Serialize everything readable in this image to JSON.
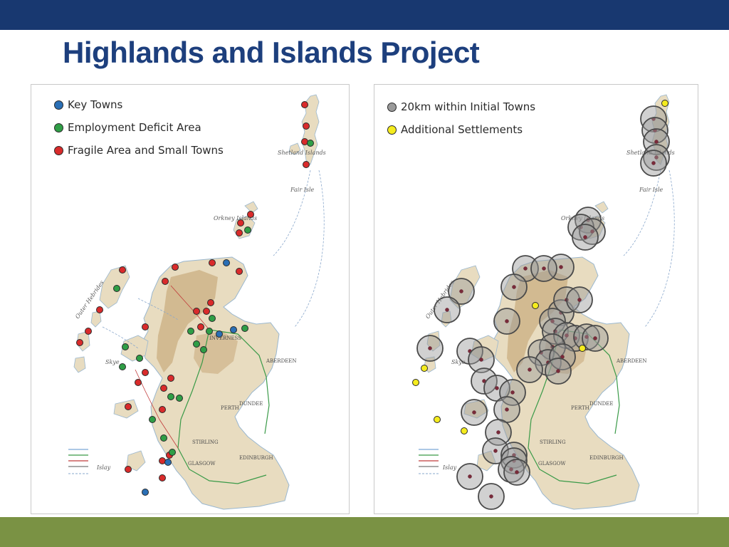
{
  "slide": {
    "title": "Highlands and Islands Project"
  },
  "colors": {
    "top_band": "#183870",
    "bottom_band": "#7a9244",
    "title": "#1d3f7d",
    "key_towns": "#2a6fb5",
    "employment_deficit": "#2f9e46",
    "fragile_area": "#d92b2b",
    "buffer_ring": "#9a9a9a",
    "additional_settlement": "#f5ec1e",
    "sea": "#ffffff",
    "land": "#e8dcc0",
    "upland": "#c9ab7e"
  },
  "left_map": {
    "legend": [
      {
        "label": "Key Towns",
        "color": "#2a6fb5"
      },
      {
        "label": "Employment Deficit Area",
        "color": "#2f9e46"
      },
      {
        "label": "Fragile Area and Small Towns",
        "color": "#d92b2b"
      }
    ],
    "labels": {
      "shetland": "Shetland Islands",
      "orkney": "Orkney Islands",
      "hebrides": "Outer Hebrides",
      "inverness": "INVERNESS",
      "aberdeen": "ABERDEEN",
      "dundee": "DUNDEE",
      "perth": "PERTH",
      "stirling": "STIRLING",
      "glasgow": "GLASGOW",
      "edinburgh": "EDINBURGH",
      "skye": "Skye",
      "islay": "Islay",
      "fair_isle": "Fair Isle"
    }
  },
  "right_map": {
    "legend": [
      {
        "label": "20km within Initial Towns",
        "color": "#9a9a9a"
      },
      {
        "label": "Additional Settlements",
        "color": "#f5ec1e"
      }
    ],
    "labels": {
      "shetland": "Shetland Islands",
      "orkney": "Orkney Islands",
      "hebrides": "Outer Hebrides",
      "aberdeen": "ABERDEEN",
      "dundee": "DUNDEE",
      "perth": "PERTH",
      "stirling": "STIRLING",
      "glasgow": "GLASGOW",
      "edinburgh": "EDINBURGH",
      "skye": "Skye",
      "islay": "Islay",
      "fair_isle": "Fair Isle"
    }
  }
}
